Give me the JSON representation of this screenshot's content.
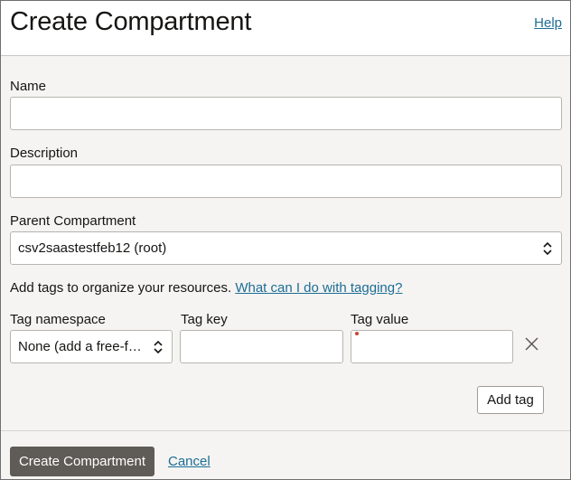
{
  "header": {
    "title": "Create Compartment",
    "help_label": "Help"
  },
  "form": {
    "name": {
      "label": "Name",
      "value": "",
      "placeholder": ""
    },
    "description": {
      "label": "Description",
      "value": "",
      "placeholder": ""
    },
    "parent_compartment": {
      "label": "Parent Compartment",
      "selected": "csv2saastestfeb12 (root)"
    },
    "tags": {
      "intro_text": "Add tags to organize your resources.",
      "intro_link": "What can I do with tagging?",
      "namespace": {
        "label": "Tag namespace",
        "selected": "None (add a free-form tag)"
      },
      "key": {
        "label": "Tag key",
        "value": ""
      },
      "value": {
        "label": "Tag value",
        "value": ""
      },
      "remove_icon": "close-icon",
      "add_tag_label": "Add tag"
    }
  },
  "footer": {
    "submit_label": "Create Compartment",
    "cancel_label": "Cancel"
  },
  "colors": {
    "link": "#1d6d96",
    "primary_button": "#5f5b56",
    "required_indicator": "#c74634",
    "panel_background": "#f5f4f2"
  }
}
